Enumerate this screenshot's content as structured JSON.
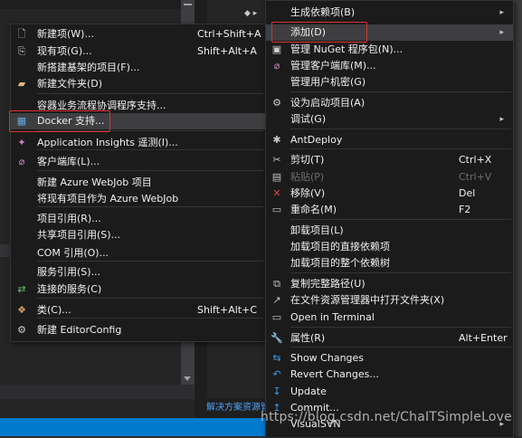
{
  "background": {
    "solution_explorer_tab": "解决方案资源管"
  },
  "add_submenu": {
    "items": [
      {
        "icon": "new-item-icon",
        "label": "新建项(W)...",
        "shortcut": "Ctrl+Shift+A"
      },
      {
        "icon": "existing-item-icon",
        "label": "现有项(G)...",
        "shortcut": "Shift+Alt+A"
      },
      {
        "icon": "",
        "label": "新搭建基架的项目(F)...",
        "shortcut": ""
      },
      {
        "icon": "new-folder-icon",
        "label": "新建文件夹(D)",
        "shortcut": ""
      },
      {
        "icon": "",
        "label": "容器业务流程协调程序支持...",
        "shortcut": ""
      },
      {
        "icon": "docker-icon",
        "label": "Docker 支持...",
        "shortcut": ""
      },
      {
        "icon": "application-insights-icon",
        "label": "Application Insights 遥测(I)...",
        "shortcut": ""
      },
      {
        "icon": "client-library-icon",
        "label": "客户端库(L)...",
        "shortcut": ""
      },
      {
        "icon": "",
        "label": "新建 Azure WebJob 项目",
        "shortcut": ""
      },
      {
        "icon": "",
        "label": "将现有项目作为 Azure WebJob",
        "shortcut": ""
      },
      {
        "icon": "",
        "label": "项目引用(R)...",
        "shortcut": ""
      },
      {
        "icon": "",
        "label": "共享项目引用(S)...",
        "shortcut": ""
      },
      {
        "icon": "",
        "label": "COM 引用(O)...",
        "shortcut": ""
      },
      {
        "icon": "",
        "label": "服务引用(S)...",
        "shortcut": ""
      },
      {
        "icon": "connected-service-icon",
        "label": "连接的服务(C)",
        "shortcut": ""
      },
      {
        "icon": "class-icon",
        "label": "类(C)...",
        "shortcut": "Shift+Alt+C"
      },
      {
        "icon": "editorconfig-icon",
        "label": "新建 EditorConfig",
        "shortcut": ""
      }
    ]
  },
  "context_menu": {
    "items": [
      {
        "icon": "",
        "label": "生成依赖项(B)",
        "shortcut": "",
        "arrow": "▸",
        "disabled": false
      },
      {
        "icon": "",
        "label": "添加(D)",
        "shortcut": "",
        "arrow": "▸",
        "disabled": false
      },
      {
        "icon": "nuget-icon",
        "label": "管理 NuGet 程序包(N)...",
        "shortcut": "",
        "arrow": "",
        "disabled": false
      },
      {
        "icon": "client-library-icon",
        "label": "管理客户端库(M)...",
        "shortcut": "",
        "arrow": "",
        "disabled": false
      },
      {
        "icon": "",
        "label": "管理用户机密(G)",
        "shortcut": "",
        "arrow": "",
        "disabled": false
      },
      {
        "icon": "gear-icon",
        "label": "设为启动项目(A)",
        "shortcut": "",
        "arrow": "",
        "disabled": false
      },
      {
        "icon": "",
        "label": "调试(G)",
        "shortcut": "",
        "arrow": "▸",
        "disabled": false
      },
      {
        "icon": "antdeploy-icon",
        "label": "AntDeploy",
        "shortcut": "",
        "arrow": "",
        "disabled": false
      },
      {
        "icon": "scissors-icon",
        "label": "剪切(T)",
        "shortcut": "Ctrl+X",
        "arrow": "",
        "disabled": false
      },
      {
        "icon": "paste-icon",
        "label": "粘贴(P)",
        "shortcut": "Ctrl+V",
        "arrow": "",
        "disabled": true
      },
      {
        "icon": "remove-icon",
        "label": "移除(V)",
        "shortcut": "Del",
        "arrow": "",
        "disabled": false
      },
      {
        "icon": "rename-icon",
        "label": "重命名(M)",
        "shortcut": "F2",
        "arrow": "",
        "disabled": false
      },
      {
        "icon": "",
        "label": "卸载项目(L)",
        "shortcut": "",
        "arrow": "",
        "disabled": false
      },
      {
        "icon": "",
        "label": "加载项目的直接依赖项",
        "shortcut": "",
        "arrow": "",
        "disabled": false
      },
      {
        "icon": "",
        "label": "加载项目的整个依赖树",
        "shortcut": "",
        "arrow": "",
        "disabled": false
      },
      {
        "icon": "copy-path-icon",
        "label": "复制完整路径(U)",
        "shortcut": "",
        "arrow": "",
        "disabled": false
      },
      {
        "icon": "folder-open-icon",
        "label": "在文件资源管理器中打开文件夹(X)",
        "shortcut": "",
        "arrow": "",
        "disabled": false
      },
      {
        "icon": "terminal-icon",
        "label": "Open in Terminal",
        "shortcut": "",
        "arrow": "",
        "disabled": false
      },
      {
        "icon": "wrench-icon",
        "label": "属性(R)",
        "shortcut": "Alt+Enter",
        "arrow": "",
        "disabled": false
      },
      {
        "icon": "show-changes-icon",
        "label": "Show Changes",
        "shortcut": "",
        "arrow": "",
        "disabled": false
      },
      {
        "icon": "revert-icon",
        "label": "Revert Changes...",
        "shortcut": "",
        "arrow": "",
        "disabled": false
      },
      {
        "icon": "update-icon",
        "label": "Update",
        "shortcut": "",
        "arrow": "",
        "disabled": false
      },
      {
        "icon": "commit-icon",
        "label": "Commit...",
        "shortcut": "",
        "arrow": "",
        "disabled": false
      },
      {
        "icon": "",
        "label": "VisualSVN",
        "shortcut": "",
        "arrow": "▸",
        "disabled": false
      }
    ]
  },
  "watermark": "https://blog.csdn.net/ChaITSimpleLove"
}
